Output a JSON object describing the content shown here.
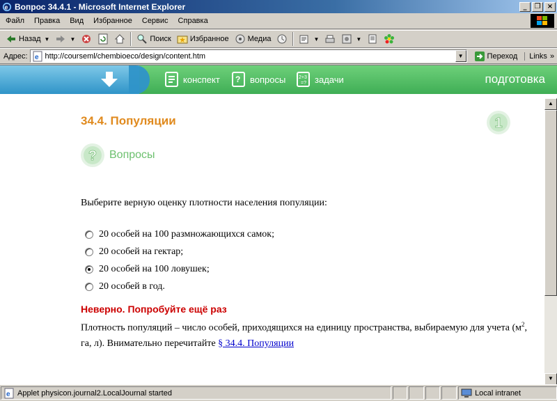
{
  "window": {
    "title": "Вопрос 34.4.1 - Microsoft Internet Explorer",
    "controls": [
      "_",
      "❐",
      "×"
    ]
  },
  "menubar": {
    "items": [
      "Файл",
      "Правка",
      "Вид",
      "Избранное",
      "Сервис",
      "Справка"
    ]
  },
  "toolbar": {
    "back": "Назад",
    "search": "Поиск",
    "favorites": "Избранное",
    "media": "Медиа"
  },
  "address": {
    "label": "Адрес:",
    "url": "http://courseml/chembioeco/design/content.htm",
    "go": "Переход",
    "links": "Links"
  },
  "site_nav": {
    "items": [
      {
        "label": "конспект",
        "icon": "notebook-icon"
      },
      {
        "label": "вопросы",
        "icon": "question-list-icon"
      },
      {
        "label": "задачи",
        "icon": "math-task-icon"
      }
    ],
    "right_label": "подготовка",
    "colors": {
      "blue": "#2f94c8",
      "green": "#3fae55"
    }
  },
  "content": {
    "section_title": "34.4. Популяции",
    "page_number": "1",
    "questions_heading": "Вопросы",
    "question": "Выберите верную оценку плотности населения популяции:",
    "options": [
      {
        "label": "20 особей на 100 размножающихся самок;",
        "checked": false
      },
      {
        "label": "20 особей на гектар;",
        "checked": false
      },
      {
        "label": "20 особей на 100 ловушек;",
        "checked": true
      },
      {
        "label": "20 особей в год.",
        "checked": false
      }
    ],
    "feedback_title": "Неверно. Попробуйте ещё раз",
    "feedback_text_1": "Плотность популяций – число особей, приходящихся на единицу пространства, выбираемую для учета (м",
    "feedback_sup": "2",
    "feedback_text_2": ", га, л). Внимательно перечитайте ",
    "feedback_link": "§ 34.4. Популяции"
  },
  "statusbar": {
    "message": "Applet physicon.journal2.LocalJournal started",
    "zone": "Local intranet"
  }
}
